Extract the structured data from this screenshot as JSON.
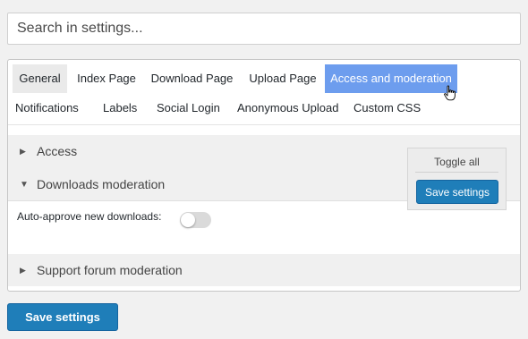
{
  "search": {
    "placeholder": "Search in settings..."
  },
  "tabs": {
    "row1": [
      {
        "label": "General"
      },
      {
        "label": "Index Page"
      },
      {
        "label": "Download Page"
      },
      {
        "label": "Upload Page"
      },
      {
        "label": "Access and moderation"
      }
    ],
    "row2": [
      {
        "label": "Notifications"
      },
      {
        "label": "Labels"
      },
      {
        "label": "Social Login"
      },
      {
        "label": "Anonymous Upload"
      },
      {
        "label": "Custom CSS"
      }
    ],
    "active": "Access and moderation"
  },
  "sections": [
    {
      "title": "Access",
      "expanded": false
    },
    {
      "title": "Downloads moderation",
      "expanded": true
    },
    {
      "title": "Support forum moderation",
      "expanded": false
    }
  ],
  "fields": {
    "auto_approve_label": "Auto-approve new downloads:",
    "auto_approve_on": false
  },
  "toolbox": {
    "toggle_all": "Toggle all",
    "save_label": "Save settings"
  },
  "footer": {
    "save_label": "Save settings"
  },
  "colors": {
    "accent": "#1f7eb9",
    "active_tab": "#6d9dee"
  }
}
